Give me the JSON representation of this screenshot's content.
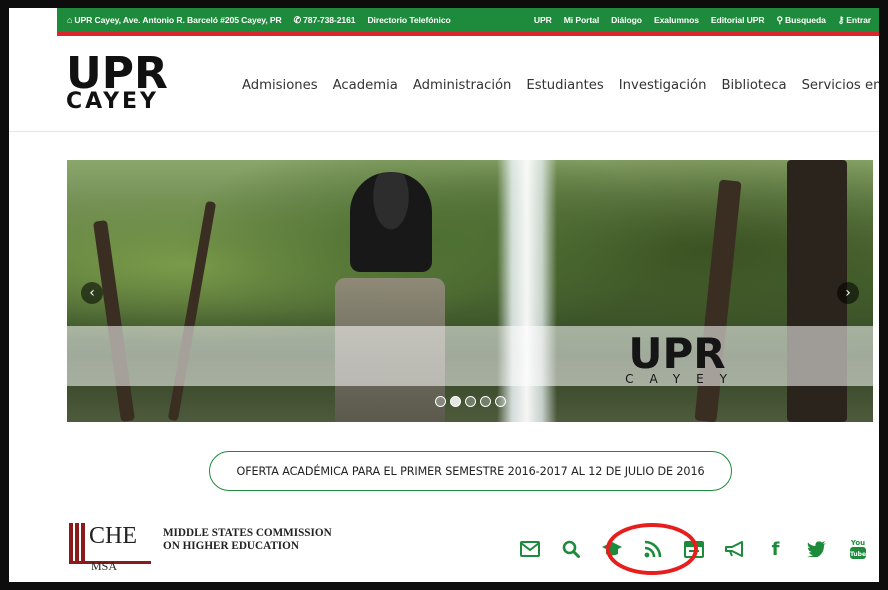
{
  "topbar": {
    "address": "UPR Cayey, Ave. Antonio R. Barceló #205 Cayey, PR",
    "phone": "787-738-2161",
    "directory": "Directorio Telefónico",
    "links": [
      "UPR",
      "Mi Portal",
      "Diálogo",
      "Exalumnos",
      "Editorial UPR"
    ],
    "search": "Busqueda",
    "login": "Entrar"
  },
  "logo": {
    "line1": "UPR",
    "line2": "CAYEY"
  },
  "nav": [
    "Admisiones",
    "Academia",
    "Administración",
    "Estudiantes",
    "Investigación",
    "Biblioteca",
    "Servicios en línea"
  ],
  "hero": {
    "band_logo_line1": "UPR",
    "band_logo_line2": "CAYEY",
    "slides": 5,
    "active_slide": 2
  },
  "offer": "OFERTA ACADÉMICA PARA EL PRIMER SEMESTRE 2016-2017 AL 12 DE JULIO DE 2016",
  "msche": {
    "che": "CHE",
    "msa": "MSA",
    "line1": "MIDDLE STATES COMMISSION",
    "line2": "ON HIGHER EDUCATION"
  },
  "social_icons": [
    "mail-icon",
    "search-icon",
    "graduation-cap-icon",
    "rss-icon",
    "calendar-icon",
    "megaphone-icon",
    "facebook-icon",
    "twitter-icon",
    "youtube-icon"
  ],
  "social_labels": {
    "facebook": "f",
    "youtube": "You Tube"
  },
  "colors": {
    "green": "#1e8a3b",
    "red": "#d9262b",
    "highlight": "#e61e1e"
  }
}
